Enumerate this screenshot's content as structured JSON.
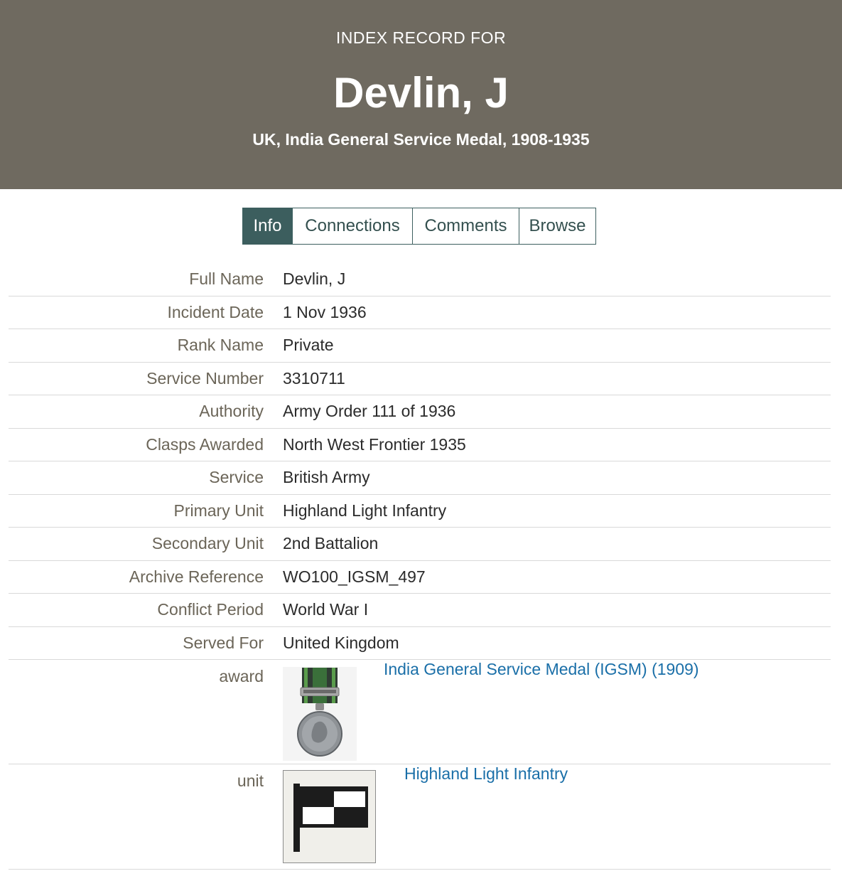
{
  "header": {
    "eyebrow": "INDEX RECORD FOR",
    "title": "Devlin, J",
    "subtitle": "UK, India General Service Medal, 1908-1935"
  },
  "tabs": [
    {
      "label": "Info",
      "active": true
    },
    {
      "label": "Connections",
      "active": false
    },
    {
      "label": "Comments",
      "active": false
    },
    {
      "label": "Browse",
      "active": false
    }
  ],
  "fields": [
    {
      "label": "Full Name",
      "value": "Devlin, J"
    },
    {
      "label": "Incident Date",
      "value": "1 Nov 1936"
    },
    {
      "label": "Rank Name",
      "value": "Private"
    },
    {
      "label": "Service Number",
      "value": "3310711"
    },
    {
      "label": "Authority",
      "value": "Army Order 111 of 1936"
    },
    {
      "label": "Clasps Awarded",
      "value": "North West Frontier 1935"
    },
    {
      "label": "Service",
      "value": "British Army"
    },
    {
      "label": "Primary Unit",
      "value": "Highland Light Infantry"
    },
    {
      "label": "Secondary Unit",
      "value": "2nd Battalion"
    },
    {
      "label": "Archive Reference",
      "value": "WO100_IGSM_497"
    },
    {
      "label": "Conflict Period",
      "value": "World War I"
    },
    {
      "label": "Served For",
      "value": "United Kingdom"
    }
  ],
  "award": {
    "label": "award",
    "link_text": "India General Service Medal (IGSM) (1909)",
    "image_icon": "medal-icon"
  },
  "unit": {
    "label": "unit",
    "link_text": "Highland Light Infantry",
    "image_icon": "flag-icon"
  },
  "colors": {
    "header_bg": "#6f6a60",
    "tab_active_bg": "#3c5e5e",
    "link": "#1a6fa8",
    "label_text": "#6b6558"
  }
}
